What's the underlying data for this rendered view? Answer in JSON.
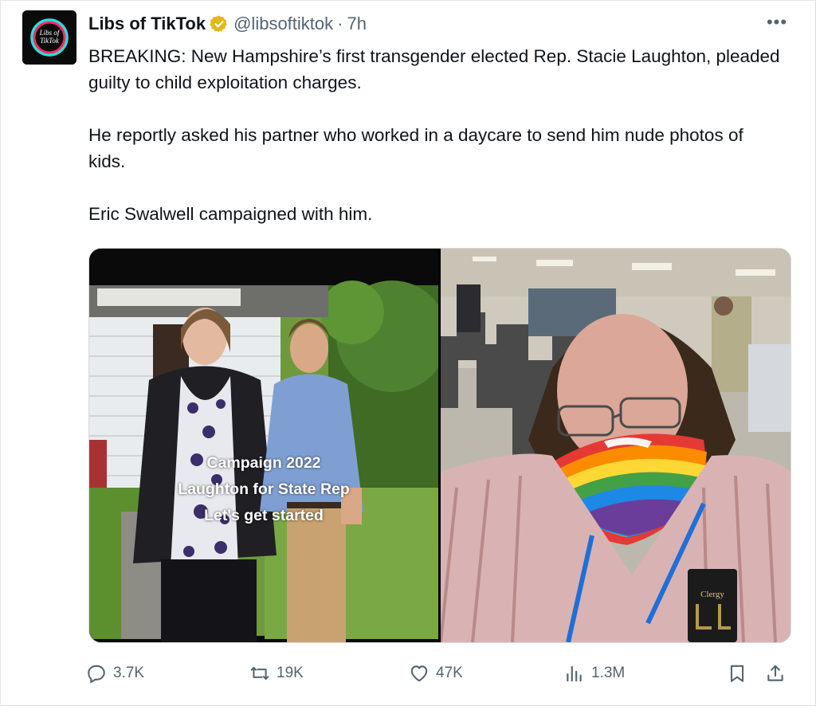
{
  "tweet": {
    "author_name": "Libs of TikTok",
    "avatar_text_line1": "Libs of",
    "avatar_text_line2": "TikTok",
    "handle": "@libsoftiktok",
    "separator": "·",
    "time": "7h",
    "more_label": "•••",
    "paragraphs": [
      "BREAKING: New Hampshire’s first transgender elected Rep. Stacie Laughton, pleaded guilty to child exploitation charges.",
      "He reportly asked his partner who worked in a daycare to send him nude photos of kids.",
      "Eric Swalwell campaigned with him."
    ]
  },
  "media": {
    "left_caption_lines": [
      "Campaign 2022",
      "Laughton for State Rep",
      "Let's get started"
    ],
    "right_badge_text": "Clergy"
  },
  "actions": {
    "replies": "3.7K",
    "reposts": "19K",
    "likes": "47K",
    "views": "1.3M"
  },
  "colors": {
    "text_primary": "#0f1419",
    "text_secondary": "#536471",
    "verified_gold": "#e2b719",
    "border": "#e6e6e6"
  },
  "icons": {
    "verified": "verified-badge-icon",
    "more": "more-horizontal-icon",
    "reply": "reply-icon",
    "repost": "repost-icon",
    "like": "heart-icon",
    "views": "views-icon",
    "bookmark": "bookmark-icon",
    "share": "share-icon"
  }
}
